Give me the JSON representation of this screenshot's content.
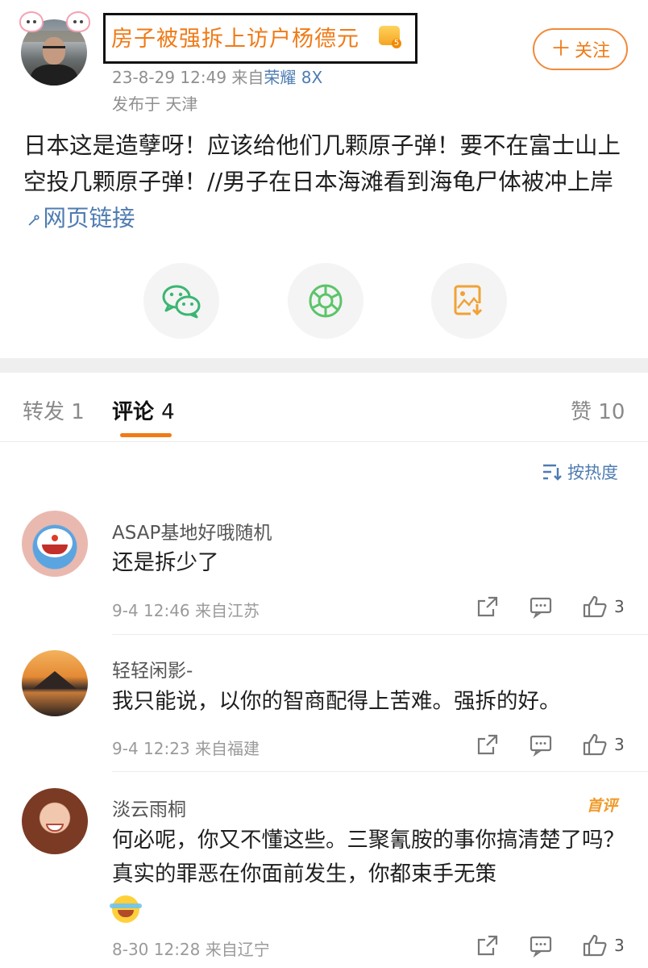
{
  "post": {
    "author_name": "房子被强拆上访户杨德元",
    "timestamp": "23-8-29 12:49",
    "source_prefix": "来自",
    "device": "荣耀 8X",
    "location": "发布于 天津",
    "follow_label": "关注",
    "follow_plus": "＋",
    "text": "日本这是造孽呀！应该给他们几颗原子弹！要不在富士山上空投几颗原子弹！//男子在日本海滩看到海龟尸体被冲上岸",
    "link_label": "网页链接",
    "share_targets": [
      "wechat-icon",
      "moments-icon",
      "save-image-icon"
    ]
  },
  "tabs": {
    "repost_label": "转发",
    "repost_count": "1",
    "comment_label": "评论",
    "comment_count": "4",
    "like_label": "赞",
    "like_count": "10"
  },
  "sort": {
    "label": "按热度"
  },
  "comments": [
    {
      "name": "ASAP基地好哦随机",
      "text": "还是拆少了",
      "meta": "9-4 12:46 来自江苏",
      "likes": "3"
    },
    {
      "name": "轻轻闲影-",
      "text": "我只能说，以你的智商配得上苦难。强拆的好。",
      "meta": "9-4 12:23 来自福建",
      "likes": "3"
    },
    {
      "name": "淡云雨桐",
      "badge": "首评",
      "text": "何必呢，你又不懂这些。三聚氰胺的事你搞清楚了吗？真实的罪恶在你面前发生，你都束手无策",
      "meta": "8-30 12:28 来自辽宁",
      "likes": "3"
    }
  ],
  "colors": {
    "accent_orange": "#f07a16",
    "link_blue": "#4e7cb2",
    "wechat_green": "#3bb672",
    "moments_green": "#5cc46a",
    "save_orange": "#f0a236"
  }
}
